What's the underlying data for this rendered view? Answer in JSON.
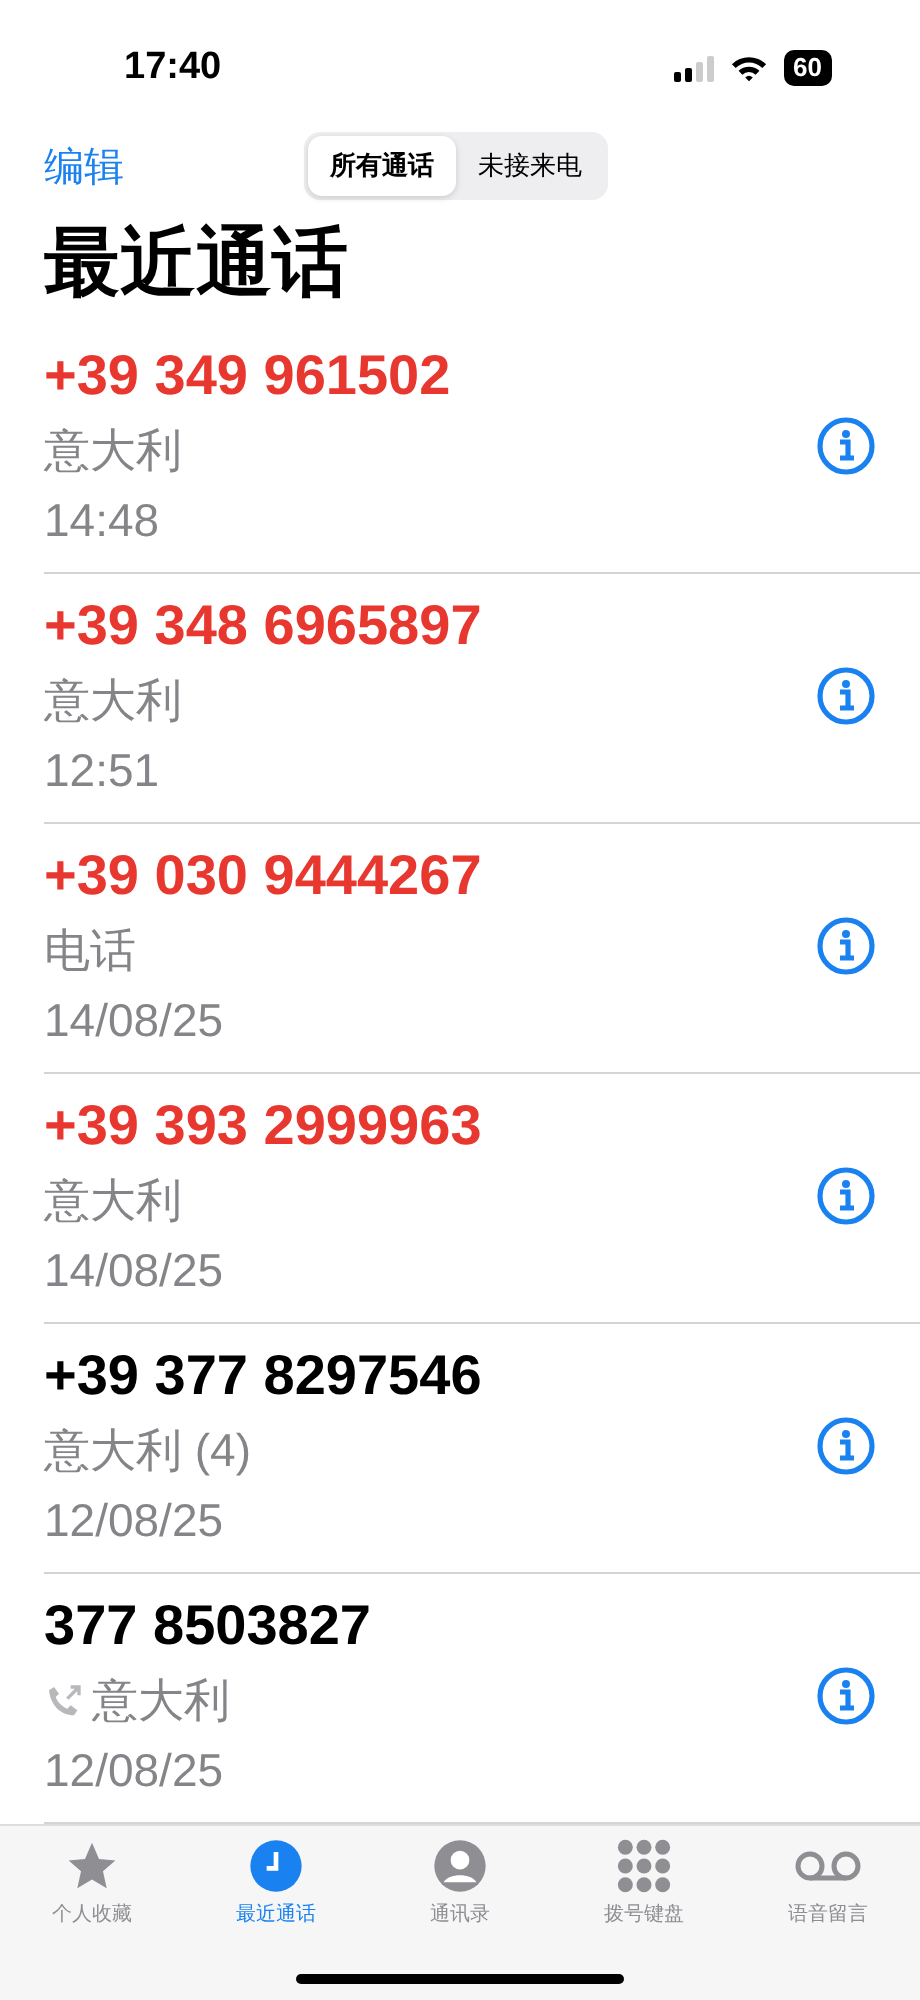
{
  "status_bar": {
    "time": "17:40",
    "battery": "60"
  },
  "nav": {
    "edit": "编辑",
    "segments": [
      {
        "label": "所有通话",
        "selected": true
      },
      {
        "label": "未接来电",
        "selected": false
      }
    ]
  },
  "title": "最近通话",
  "calls": [
    {
      "number": "+39 349 961502",
      "label": "意大利",
      "time": "14:48",
      "missed": true,
      "outgoing": false
    },
    {
      "number": "+39 348 6965897",
      "label": "意大利",
      "time": "12:51",
      "missed": true,
      "outgoing": false
    },
    {
      "number": "+39 030 9444267",
      "label": "电话",
      "time": "14/08/25",
      "missed": true,
      "outgoing": false
    },
    {
      "number": "+39 393 2999963",
      "label": "意大利",
      "time": "14/08/25",
      "missed": true,
      "outgoing": false
    },
    {
      "number": "+39 377 8297546",
      "label": "意大利 (4)",
      "time": "12/08/25",
      "missed": false,
      "outgoing": false
    },
    {
      "number": "377 8503827",
      "label": "意大利",
      "time": "12/08/25",
      "missed": false,
      "outgoing": true
    }
  ],
  "tab_bar": [
    {
      "label": "个人收藏",
      "kind": "star",
      "selected": false
    },
    {
      "label": "最近通话",
      "kind": "clock",
      "selected": true
    },
    {
      "label": "通讯录",
      "kind": "person",
      "selected": false
    },
    {
      "label": "拨号键盘",
      "kind": "keypad",
      "selected": false
    },
    {
      "label": "语音留言",
      "kind": "voicemail",
      "selected": false
    }
  ]
}
